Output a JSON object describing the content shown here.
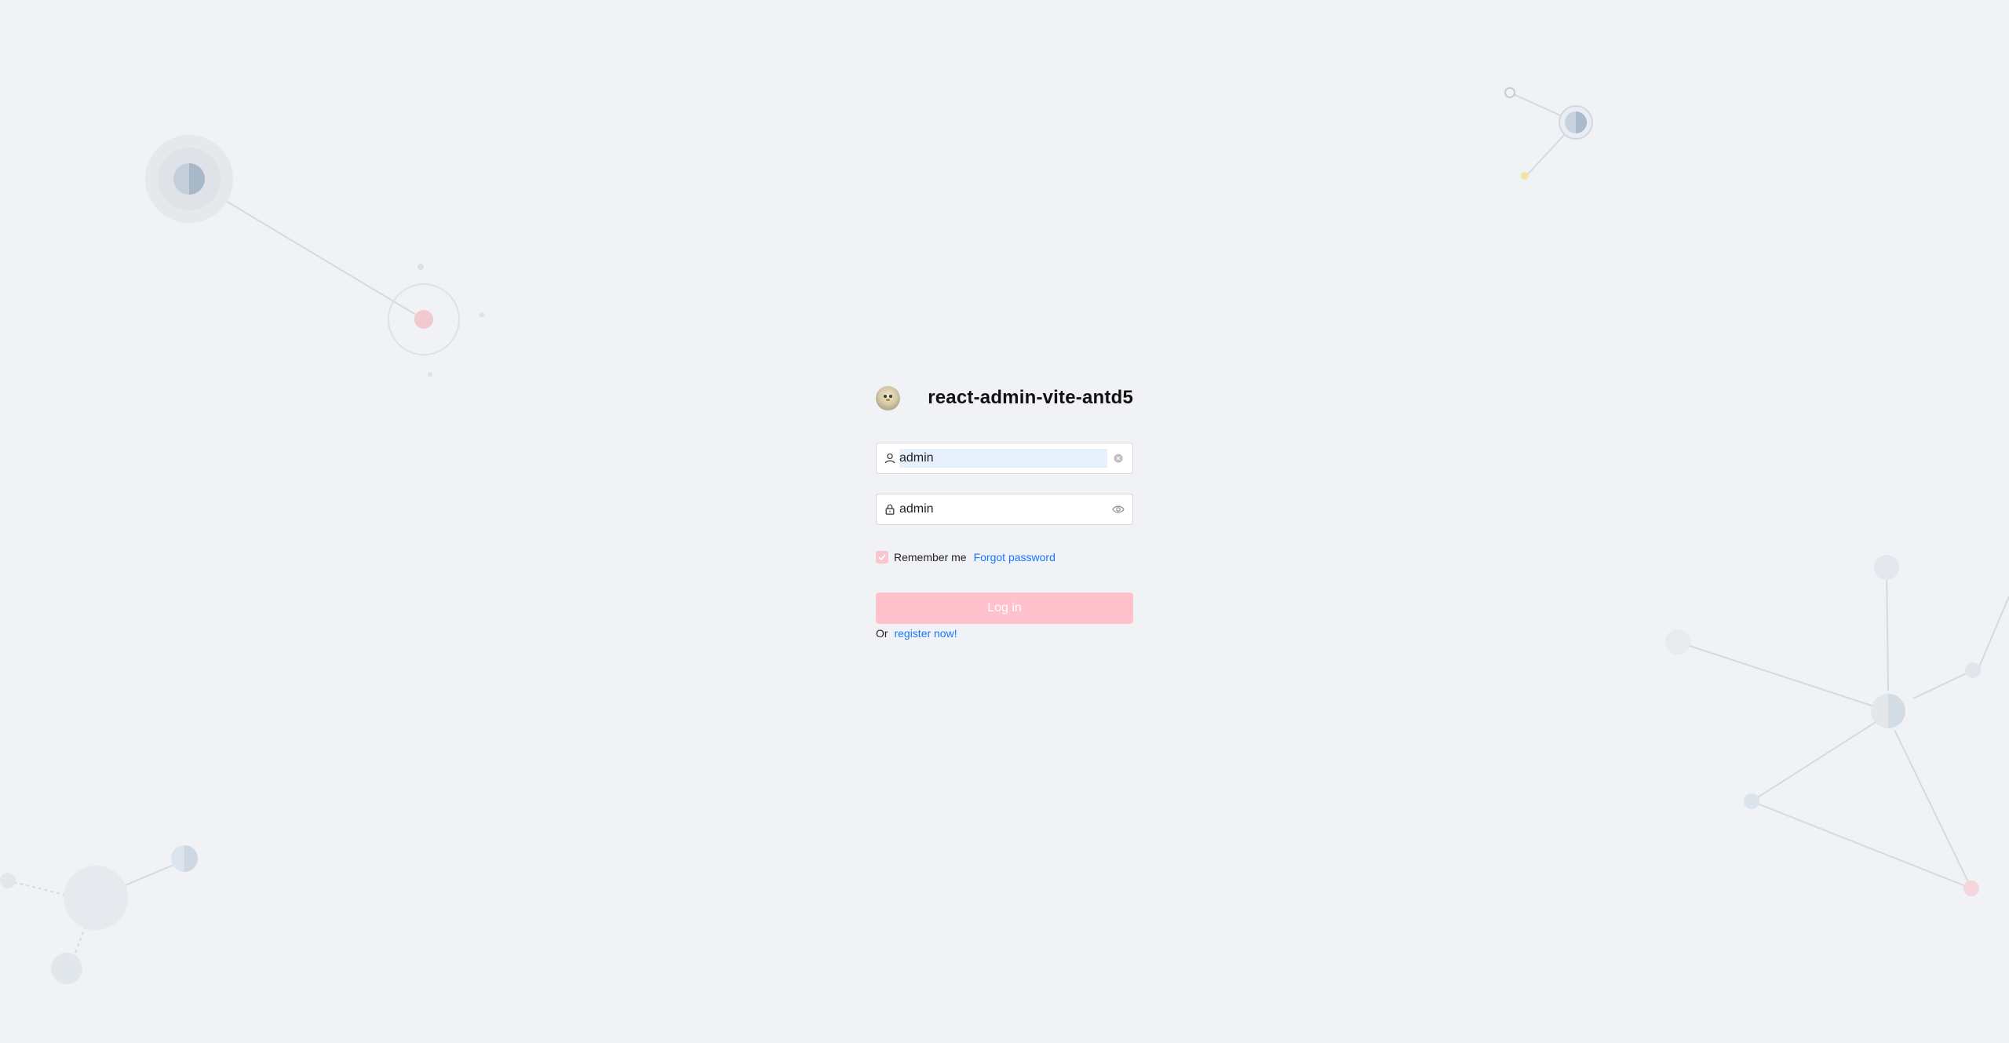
{
  "app": {
    "title": "react-admin-vite-antd5",
    "logo_icon": "bird-avatar-logo"
  },
  "form": {
    "username": {
      "value": "admin",
      "prefix_icon": "user-icon",
      "suffix_icon": "clear-icon"
    },
    "password": {
      "value": "admin",
      "prefix_icon": "lock-icon",
      "suffix_icon": "eye-icon"
    },
    "remember_label": "Remember me",
    "remember_checked": true,
    "forgot_label": "Forgot password",
    "login_label": "Log in",
    "register_prefix": "Or",
    "register_label": "register now!"
  },
  "colors": {
    "background": "#f0f2f5",
    "primary_disabled": "#ffc1cc",
    "link": "#1677ff",
    "autofill": "#e8f0fe"
  }
}
